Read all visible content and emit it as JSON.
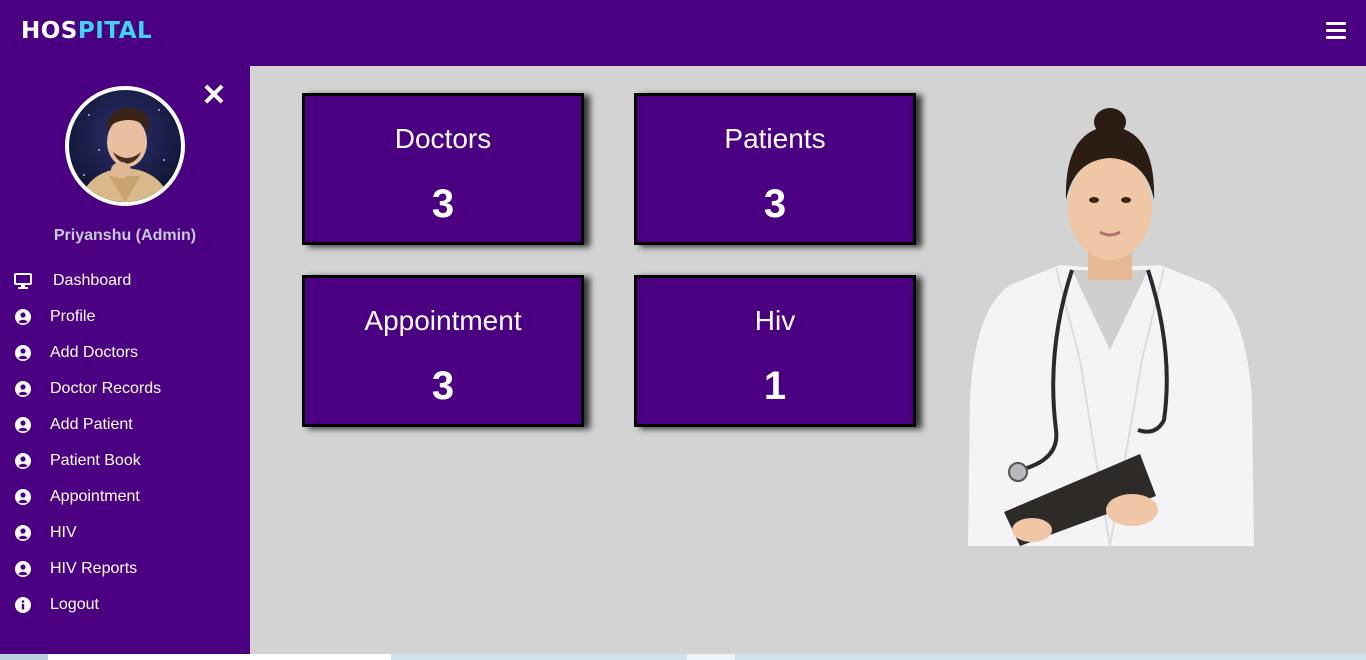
{
  "brand": {
    "part1": "HOS",
    "part2": "PITAL"
  },
  "user": {
    "name": "Priyanshu (Admin)"
  },
  "sidebar": {
    "items": [
      {
        "label": "Dashboard",
        "icon": "monitor-icon"
      },
      {
        "label": "Profile",
        "icon": "user-circle-icon"
      },
      {
        "label": "Add Doctors",
        "icon": "user-circle-icon"
      },
      {
        "label": "Doctor Records",
        "icon": "user-circle-icon"
      },
      {
        "label": "Add Patient",
        "icon": "user-circle-icon"
      },
      {
        "label": "Patient Book",
        "icon": "user-circle-icon"
      },
      {
        "label": "Appointment",
        "icon": "user-circle-icon"
      },
      {
        "label": "HIV",
        "icon": "user-circle-icon"
      },
      {
        "label": "HIV Reports",
        "icon": "user-circle-icon"
      },
      {
        "label": "Logout",
        "icon": "info-circle-icon"
      }
    ]
  },
  "cards": [
    {
      "title": "Doctors",
      "value": "3"
    },
    {
      "title": "Patients",
      "value": "3"
    },
    {
      "title": "Appointment",
      "value": "3"
    },
    {
      "title": "Hiv",
      "value": "1"
    }
  ],
  "colors": {
    "primary": "#4b0082",
    "accent": "#3fd3f1",
    "background": "#d3d3d3"
  }
}
